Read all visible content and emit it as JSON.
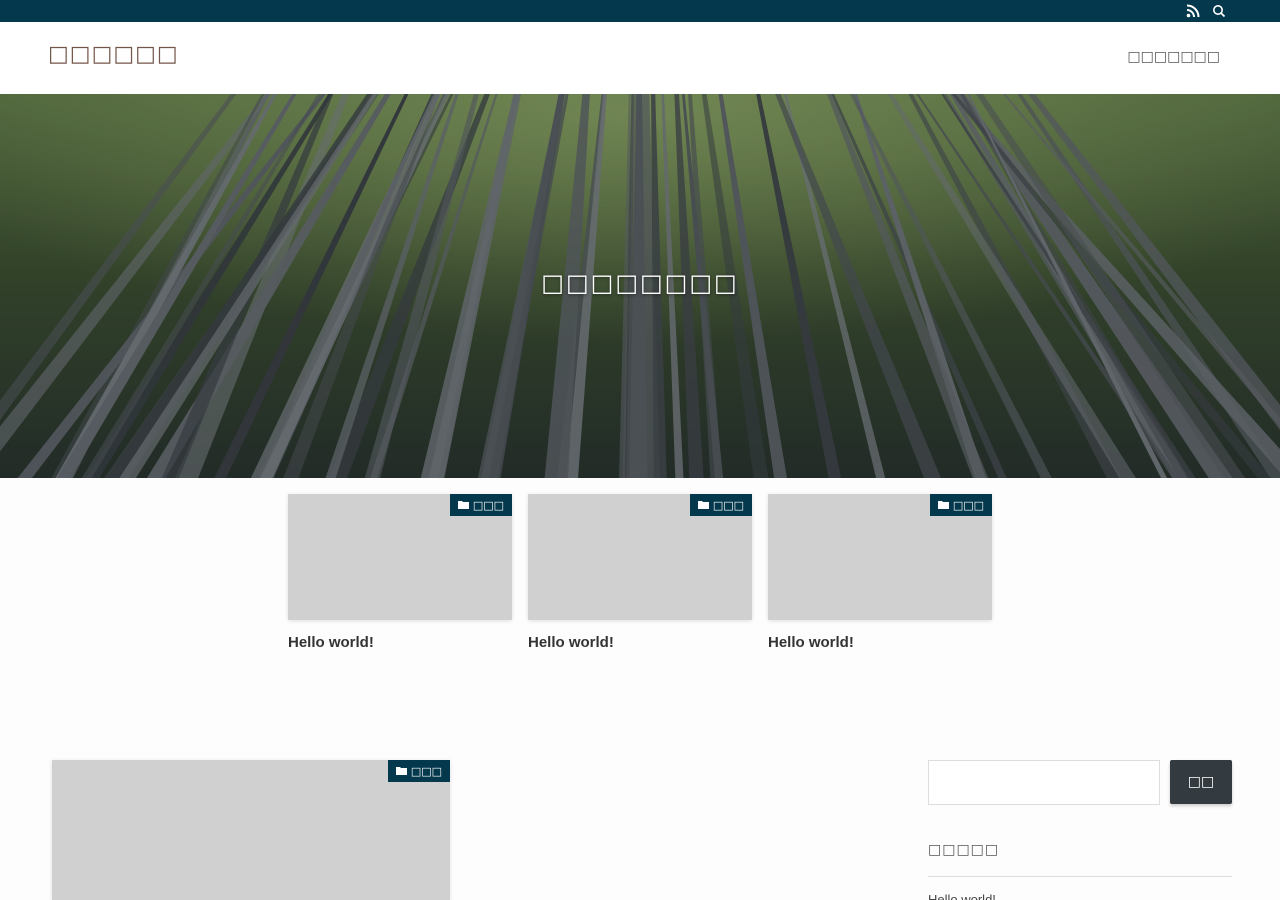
{
  "topbar": {
    "icons": [
      "rss-icon",
      "search-icon"
    ],
    "bg_color": "#04384c"
  },
  "header": {
    "site_title": "□□□□□□",
    "nav_item": "□□□□□□□"
  },
  "hero": {
    "tagline": "□□□□□□□□"
  },
  "cards": [
    {
      "category": "□□□",
      "title": "Hello world!"
    },
    {
      "category": "□□□",
      "title": "Hello world!"
    },
    {
      "category": "□□□",
      "title": "Hello world!"
    }
  ],
  "main_post": {
    "category": "□□□"
  },
  "sidebar": {
    "search_button": "□□",
    "search_placeholder": "",
    "widget_title": "□□□□□",
    "widget_item": "Hello world!"
  },
  "colors": {
    "accent": "#04384c",
    "title": "#74574b",
    "button": "#333b40"
  }
}
